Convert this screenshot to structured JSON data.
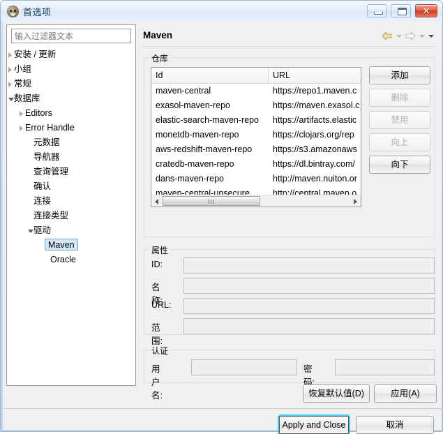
{
  "window": {
    "title": "首选项",
    "icon": "dbeaver-icon",
    "controls": {
      "minimize": "minimize-icon",
      "maximize": "maximize-icon",
      "close": "✕"
    }
  },
  "sidebar": {
    "filter": {
      "placeholder": "输入过滤器文本",
      "value": ""
    },
    "tree": [
      {
        "label": "安装 / 更新",
        "indent": 10,
        "twisty": "collapsed",
        "selected": false
      },
      {
        "label": "小组",
        "indent": 10,
        "twisty": "collapsed",
        "selected": false
      },
      {
        "label": "常规",
        "indent": 10,
        "twisty": "collapsed",
        "selected": false
      },
      {
        "label": "数据库",
        "indent": 10,
        "twisty": "expanded",
        "selected": false
      },
      {
        "label": "Editors",
        "indent": 26,
        "twisty": "collapsed",
        "selected": false
      },
      {
        "label": "Error Handle",
        "indent": 26,
        "twisty": "collapsed",
        "selected": false
      },
      {
        "label": "元数据",
        "indent": 38,
        "twisty": "none",
        "selected": false
      },
      {
        "label": "导航器",
        "indent": 38,
        "twisty": "none",
        "selected": false
      },
      {
        "label": "查询管理",
        "indent": 38,
        "twisty": "none",
        "selected": false
      },
      {
        "label": "确认",
        "indent": 38,
        "twisty": "none",
        "selected": false
      },
      {
        "label": "连接",
        "indent": 38,
        "twisty": "none",
        "selected": false
      },
      {
        "label": "连接类型",
        "indent": 38,
        "twisty": "none",
        "selected": false
      },
      {
        "label": "驱动",
        "indent": 38,
        "twisty": "expanded",
        "selected": false
      },
      {
        "label": "Maven",
        "indent": 58,
        "twisty": "none",
        "selected": true
      },
      {
        "label": "Oracle",
        "indent": 62,
        "twisty": "none",
        "selected": false
      }
    ]
  },
  "page": {
    "title": "Maven",
    "nav": {
      "back": "back-arrow-icon",
      "back_menu": "chevron-down-icon",
      "forward": "forward-arrow-icon",
      "forward_menu": "chevron-down-icon",
      "view_menu": "chevron-down-icon"
    }
  },
  "repositories": {
    "group_title": "仓库",
    "columns": [
      "Id",
      "URL"
    ],
    "rows": [
      {
        "id": "maven-central",
        "url": "https://repo1.maven.c"
      },
      {
        "id": "exasol-maven-repo",
        "url": "https://maven.exasol.c"
      },
      {
        "id": "elastic-search-maven-repo",
        "url": "https://artifacts.elastic"
      },
      {
        "id": "monetdb-maven-repo",
        "url": "https://clojars.org/rep"
      },
      {
        "id": "aws-redshift-maven-repo",
        "url": "https://s3.amazonaws"
      },
      {
        "id": "cratedb-maven-repo",
        "url": "https://dl.bintray.com/"
      },
      {
        "id": "dans-maven-repo",
        "url": "http://maven.nuiton.or"
      },
      {
        "id": "maven-central-unsecure",
        "url": "http://central.maven.o"
      }
    ],
    "buttons": [
      {
        "label": "添加",
        "enabled": true
      },
      {
        "label": "删除",
        "enabled": false
      },
      {
        "label": "禁用",
        "enabled": false
      },
      {
        "label": "向上",
        "enabled": false
      },
      {
        "label": "向下",
        "enabled": true
      }
    ]
  },
  "properties": {
    "group_title": "属性",
    "fields": [
      {
        "label": "ID:",
        "value": ""
      },
      {
        "label": "名称:",
        "value": ""
      },
      {
        "label": "URL:",
        "value": ""
      },
      {
        "label": "范围:",
        "value": ""
      }
    ]
  },
  "auth": {
    "group_title": "认证",
    "user_label": "用户名:",
    "user_value": "",
    "pass_label": "密码:",
    "pass_value": ""
  },
  "footer": {
    "restore_defaults": "恢复默认值(D)",
    "apply": "应用(A)",
    "apply_and_close": "Apply and Close",
    "cancel": "取消"
  },
  "colors": {
    "selection": "#d4e7f7",
    "focus_outline": "#51c9ef",
    "close_button": "#cf3c23",
    "back_arrow": "#f5e09a"
  }
}
